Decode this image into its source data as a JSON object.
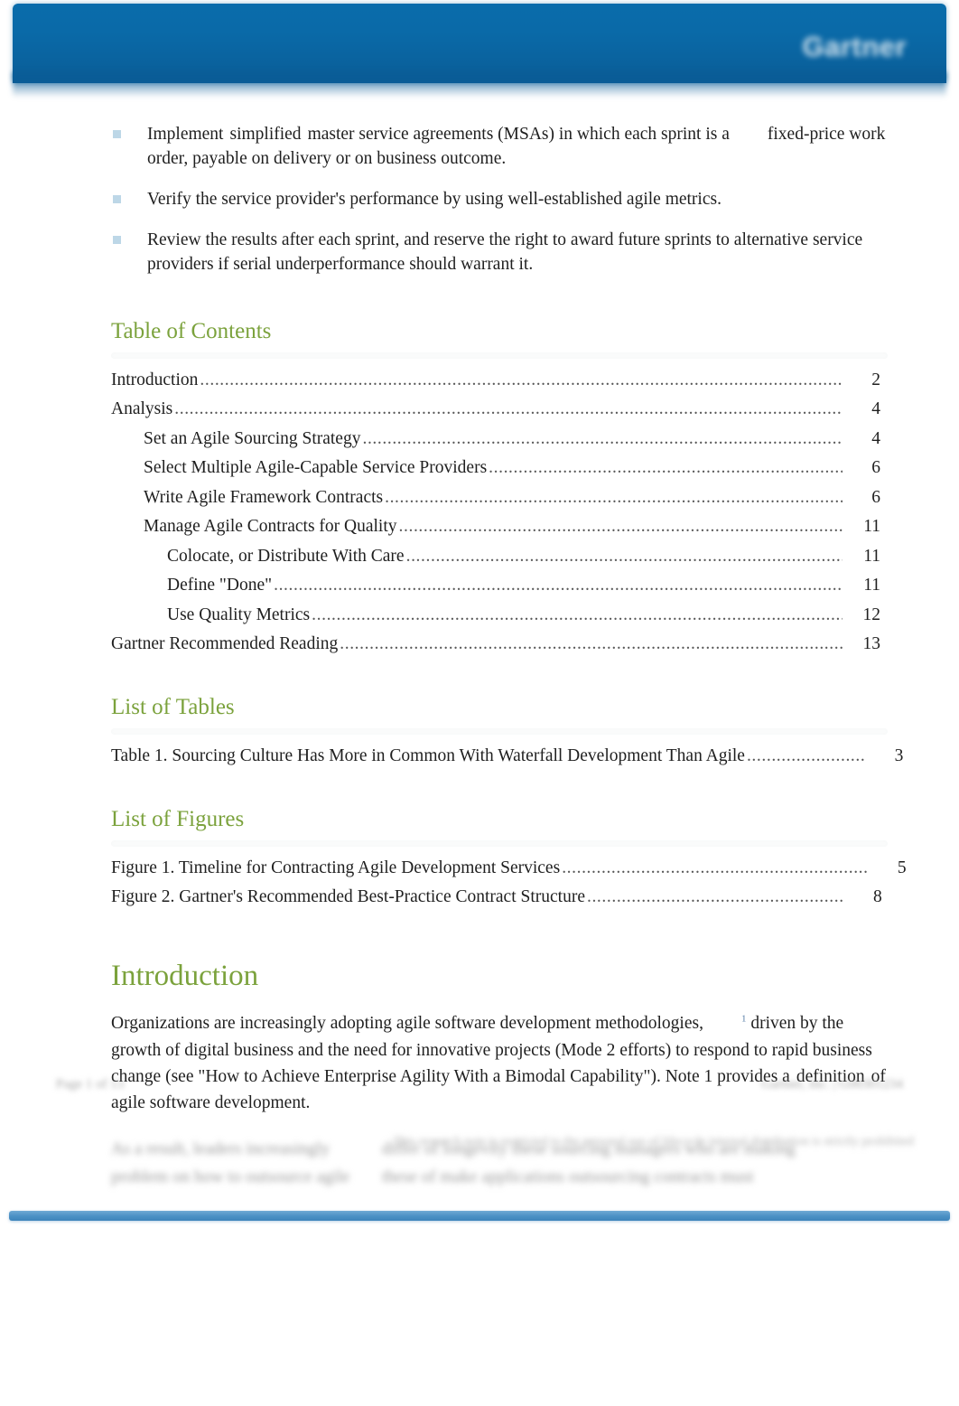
{
  "header": {
    "brand": "Gartner"
  },
  "bullets": [
    {
      "part1": "Implement",
      "part2": "simplified",
      "part3": "master service agreements (MSAs) in which each sprint is a",
      "part4": "fixed-price work order, payable on delivery or on business outcome."
    },
    {
      "text": "Verify the service provider's performance by using well-established agile metrics."
    },
    {
      "text": "Review the results after each sprint, and reserve the right to award future sprints to alternative service providers if serial underperformance should warrant it."
    }
  ],
  "toc": {
    "heading": "Table of Contents",
    "entries": [
      {
        "label": "Introduction",
        "page": "2",
        "level": 0,
        "gap": ""
      },
      {
        "label": "Analysis",
        "page": "4",
        "level": 0,
        "gap": ""
      },
      {
        "label": "Set an Agile Sourcing Strategy",
        "page": "4",
        "level": 1,
        "gap": "  "
      },
      {
        "label": "Select Multiple Agile-Capable Service Providers",
        "page": "6",
        "level": 1,
        "gap": "  "
      },
      {
        "label": "Write Agile Framework Contracts",
        "page": "6",
        "level": 1,
        "gap": " "
      },
      {
        "label": "Manage Agile Contracts for Quality",
        "page": "11",
        "level": 1,
        "gap": " "
      },
      {
        "label": "Colocate, or Distribute With Care",
        "page": "11",
        "level": 2,
        "gap": "  "
      },
      {
        "label": "Define \"Done\"",
        "page": "11",
        "level": 2,
        "gap": ""
      },
      {
        "label": "Use Quality Metrics",
        "page": "12",
        "level": 2,
        "gap": ""
      },
      {
        "label": "Gartner Recommended Reading",
        "page": "13",
        "level": 0,
        "gap": "   "
      }
    ]
  },
  "list_of_tables": {
    "heading": "List of Tables",
    "entries": [
      {
        "label": "Table 1. Sourcing Culture Has More in Common With Waterfall Development Than Agile",
        "page": "3",
        "dots": "........................"
      }
    ]
  },
  "list_of_figures": {
    "heading": "List of Figures",
    "entries": [
      {
        "label": "Figure 1. Timeline for Contracting Agile Development Services",
        "page": "5",
        "dots": ".............................................................."
      },
      {
        "label": "Figure 2. Gartner's Recommended Best-Practice Contract Structure",
        "page": "8",
        "dots": "...................................................."
      }
    ]
  },
  "introduction": {
    "heading": "Introduction",
    "paragraph_a": "Organizations are increasingly adopting agile software development methodologies,",
    "footnote_marker": "1",
    "paragraph_b": "driven by the growth of digital business and the need for innovative projects (Mode 2 efforts) to respond to rapid business change (see \"How to Achieve Enterprise Agility With a Bimodal Capability\"). Note 1 provides a",
    "paragraph_c": "definition",
    "paragraph_d": "of agile software development."
  },
  "blurred_note": {
    "line1_left": "As a result, leaders increasingly",
    "line1_right": "differ of longevity these sourcing managers who are making",
    "line2_left": "problem on how to outsource agile",
    "line2_right": "these of make applications outsourcing contracts must"
  },
  "footer": {
    "page_number": "Page 1 of 13",
    "doc_id": "Gartner, Inc. | G00301234",
    "legal": "This research note is restricted to the personal use of lifecycle internal distribution is strictly prohibited"
  },
  "colors": {
    "header_blue": "#0a6aa8",
    "heading_green": "#7ba23c",
    "footer_bar_blue": "#4a90c4",
    "bullet_marker": "#bdd7e7"
  }
}
